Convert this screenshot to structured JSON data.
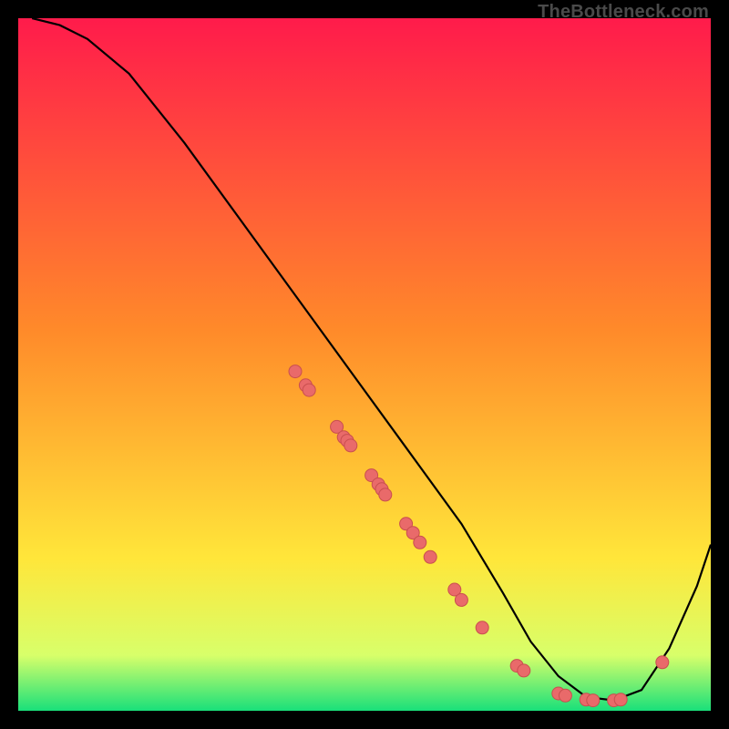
{
  "watermark": "TheBottleneck.com",
  "chart_data": {
    "type": "line",
    "title": "",
    "xlabel": "",
    "ylabel": "",
    "xlim": [
      0,
      100
    ],
    "ylim": [
      0,
      100
    ],
    "grid": false,
    "series": [
      {
        "name": "curve",
        "x": [
          2,
          6,
          10,
          16,
          24,
          32,
          40,
          48,
          56,
          64,
          70,
          74,
          78,
          82,
          86,
          90,
          94,
          98,
          100
        ],
        "y": [
          100,
          99,
          97,
          92,
          82,
          71,
          60,
          49,
          38,
          27,
          17,
          10,
          5,
          2,
          1.5,
          3,
          9,
          18,
          24
        ]
      }
    ],
    "scatter_points": {
      "name": "markers",
      "x": [
        40,
        41.5,
        42,
        46,
        47,
        47.5,
        48,
        51,
        52,
        52.5,
        53,
        56,
        57,
        58,
        59.5,
        63,
        64,
        67,
        72,
        73,
        78,
        79,
        82,
        83,
        86,
        87,
        93
      ],
      "y": [
        49.0,
        47.0,
        46.3,
        41.0,
        39.5,
        39.0,
        38.3,
        34.0,
        32.7,
        32.0,
        31.2,
        27.0,
        25.7,
        24.3,
        22.2,
        17.5,
        16.0,
        12.0,
        6.5,
        5.8,
        2.5,
        2.2,
        1.6,
        1.5,
        1.5,
        1.6,
        7.0
      ]
    },
    "legend": null
  },
  "colors": {
    "gradient_top": "#ff1b4b",
    "gradient_mid1": "#ff8a2a",
    "gradient_mid2": "#ffe63a",
    "gradient_mid3": "#d8ff6a",
    "gradient_bottom": "#19e07a",
    "curve": "#000000",
    "marker_fill": "#e96a6a",
    "marker_stroke": "#c94f4f"
  }
}
